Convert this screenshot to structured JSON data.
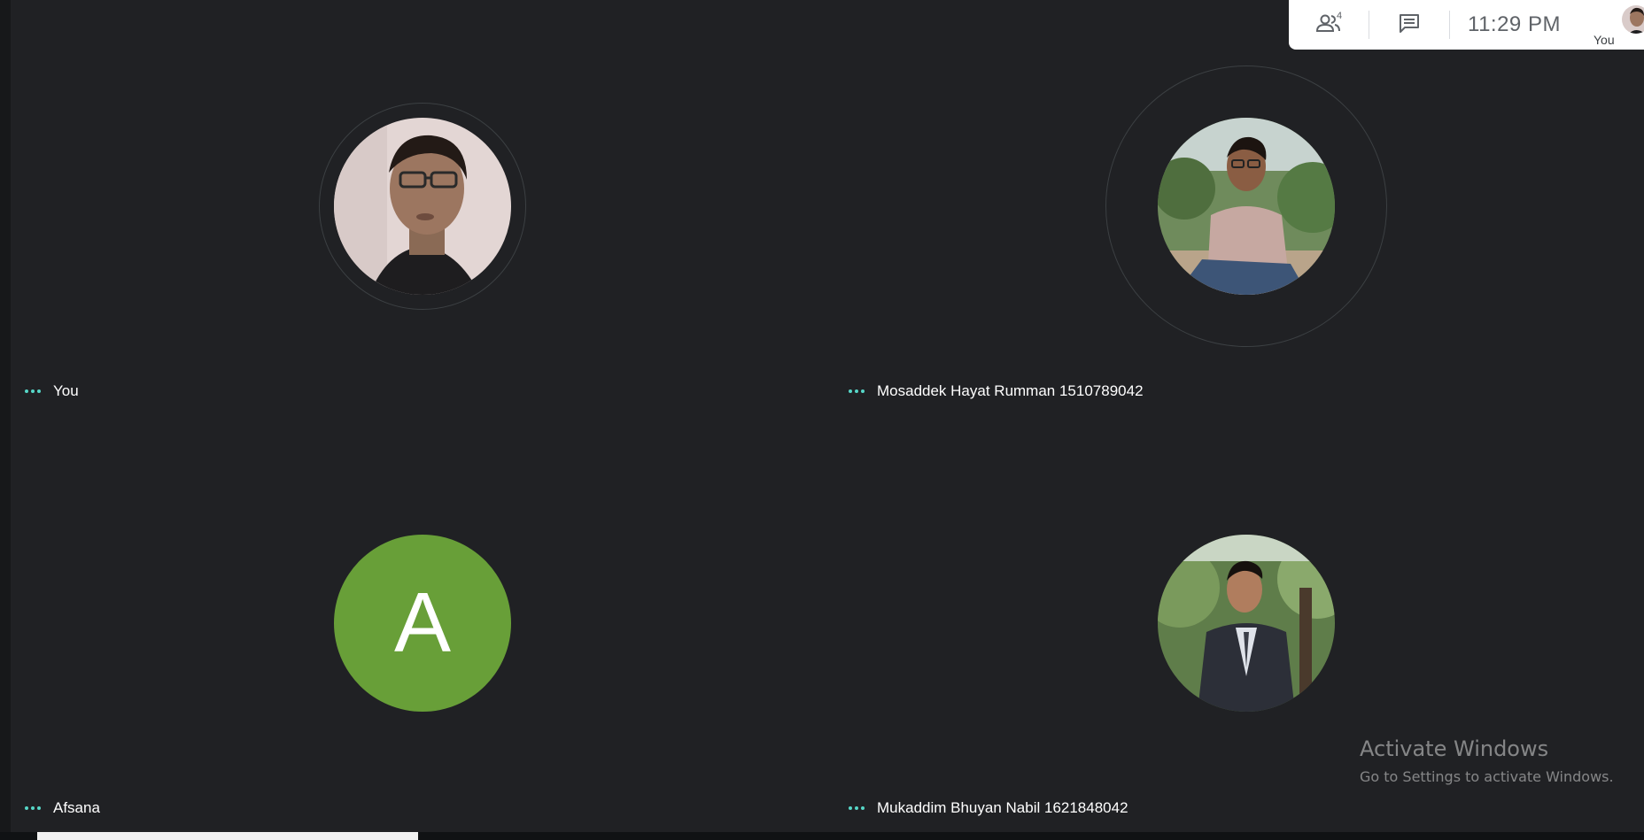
{
  "top_panel": {
    "participants_count": "4",
    "time": "11:29  PM",
    "self_label": "You"
  },
  "participants": [
    {
      "name": "You",
      "avatar": "photo-man-glasses"
    },
    {
      "name": "Mosaddek Hayat Rumman 1510789042",
      "avatar": "photo-man-sitting"
    },
    {
      "name": "Afsana",
      "avatar_letter": "A",
      "avatar_color": "#689f38"
    },
    {
      "name": "Mukaddim Bhuyan Nabil 1621848042",
      "avatar": "photo-man-suit"
    }
  ],
  "watermark": {
    "title": "Activate Windows",
    "subtitle": "Go to Settings to activate Windows."
  },
  "colors": {
    "background": "#202124",
    "accent_dots": "#56d6c7",
    "panel": "#ffffff"
  }
}
